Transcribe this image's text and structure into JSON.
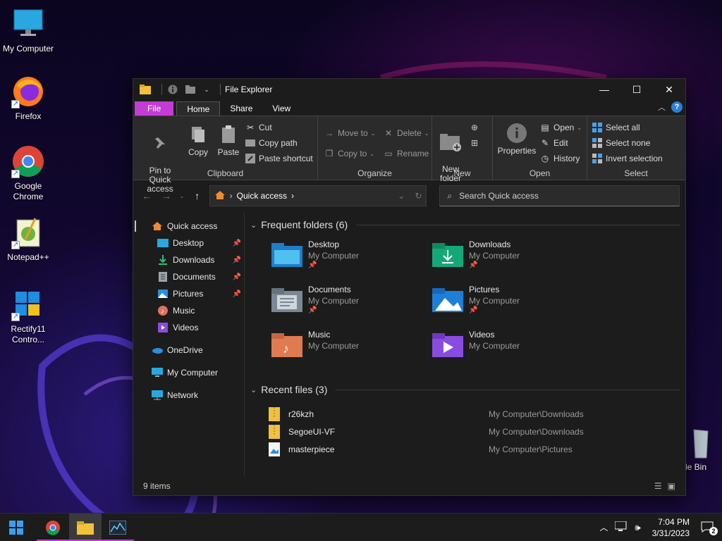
{
  "colors": {
    "accent": "#c43bd6",
    "window_bg": "#1c1c1c",
    "ribbon_bg": "#2b2b2b",
    "help": "#2a7fd6"
  },
  "desktop": {
    "icons": [
      {
        "label": "My Computer",
        "icon": "monitor-icon"
      },
      {
        "label": "Firefox",
        "icon": "firefox-icon"
      },
      {
        "label": "Google\nChrome",
        "icon": "chrome-icon"
      },
      {
        "label": "Notepad++",
        "icon": "notepadpp-icon"
      },
      {
        "label": "Rectify11\nContro...",
        "icon": "control-panel-icon"
      }
    ],
    "recycle_label": "cle Bin"
  },
  "window": {
    "title": "File Explorer",
    "tabs": {
      "file": "File",
      "home": "Home",
      "share": "Share",
      "view": "View"
    },
    "help": "?",
    "ribbon": {
      "clipboard": {
        "label": "Clipboard",
        "pin": "Pin to Quick\naccess",
        "copy": "Copy",
        "paste": "Paste",
        "cut": "Cut",
        "copy_path": "Copy path",
        "paste_shortcut": "Paste shortcut"
      },
      "organize": {
        "label": "Organize",
        "move_to": "Move to",
        "copy_to": "Copy to",
        "delete": "Delete",
        "rename": "Rename"
      },
      "new": {
        "label": "New",
        "new_folder": "New\nfolder"
      },
      "open": {
        "label": "Open",
        "properties": "Properties",
        "open": "Open",
        "edit": "Edit",
        "history": "History"
      },
      "select": {
        "label": "Select",
        "select_all": "Select all",
        "select_none": "Select none",
        "invert": "Invert selection"
      }
    },
    "address": {
      "location": "Quick access"
    },
    "search": {
      "placeholder": "Search Quick access"
    },
    "nav": {
      "quick_access": "Quick access",
      "items": [
        {
          "label": "Desktop",
          "pinned": true
        },
        {
          "label": "Downloads",
          "pinned": true
        },
        {
          "label": "Documents",
          "pinned": true
        },
        {
          "label": "Pictures",
          "pinned": true
        },
        {
          "label": "Music",
          "pinned": false
        },
        {
          "label": "Videos",
          "pinned": false
        }
      ],
      "onedrive": "OneDrive",
      "my_computer": "My Computer",
      "network": "Network"
    },
    "frequent": {
      "header": "Frequent folders (6)",
      "folders": [
        {
          "name": "Desktop",
          "location": "My Computer",
          "pinned": true
        },
        {
          "name": "Downloads",
          "location": "My Computer",
          "pinned": true
        },
        {
          "name": "Documents",
          "location": "My Computer",
          "pinned": true
        },
        {
          "name": "Pictures",
          "location": "My Computer",
          "pinned": true
        },
        {
          "name": "Music",
          "location": "My Computer",
          "pinned": false
        },
        {
          "name": "Videos",
          "location": "My Computer",
          "pinned": false
        }
      ]
    },
    "recent": {
      "header": "Recent files (3)",
      "files": [
        {
          "name": "r26kzh",
          "location": "My Computer\\Downloads",
          "icon": "zip-icon"
        },
        {
          "name": "SegoeUI-VF",
          "location": "My Computer\\Downloads",
          "icon": "zip-icon"
        },
        {
          "name": "masterpiece",
          "location": "My Computer\\Pictures",
          "icon": "image-file-icon"
        }
      ]
    },
    "status": "9 items"
  },
  "taskbar": {
    "time": "7:04 PM",
    "date": "3/31/2023",
    "notifications": "2"
  }
}
